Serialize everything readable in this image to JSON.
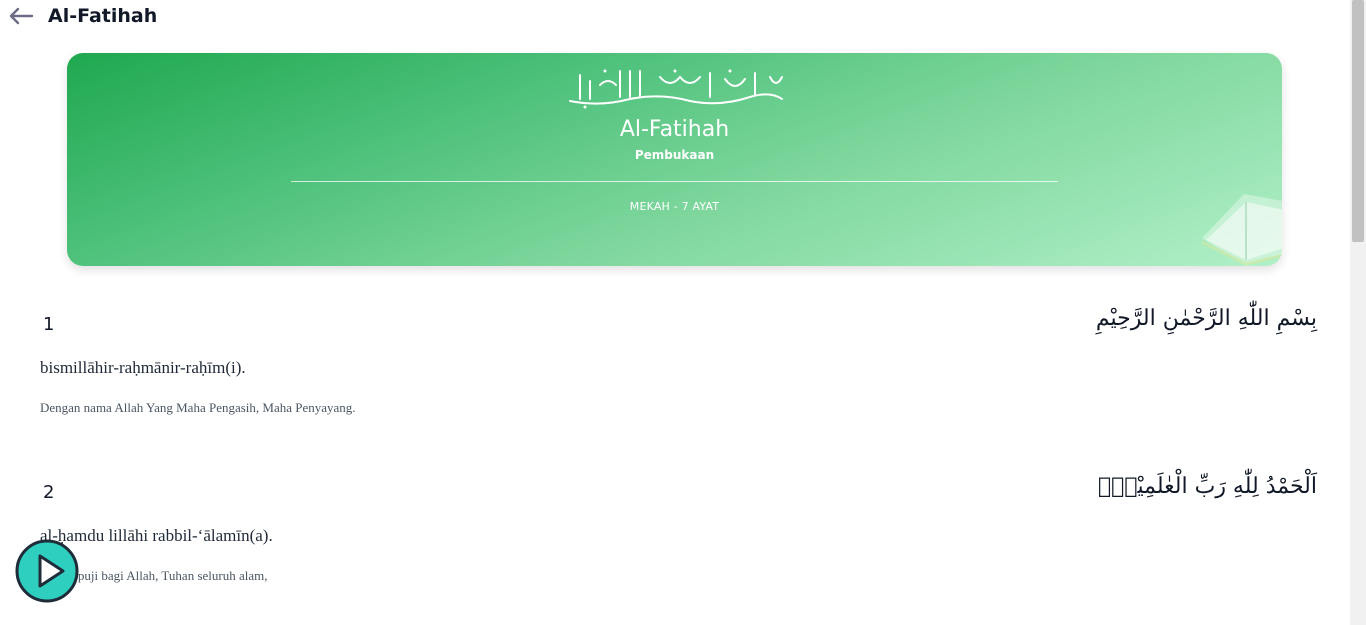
{
  "header": {
    "back_icon": "arrow-left-icon",
    "title": "Al-Fatihah"
  },
  "hero": {
    "basmala_art": "bismillah-calligraphy",
    "name": "Al-Fatihah",
    "meaning": "Pembukaan",
    "meta": "MEKAH - 7 AYAT",
    "decoration": "quran-book-icon"
  },
  "verses": [
    {
      "number": "1",
      "arabic": "بِسْمِ اللّٰهِ الرَّحْمٰنِ الرَّحِيْمِ",
      "latin": "bismillāhir-raḥmānir-raḥīm(i).",
      "translation": "Dengan nama Allah Yang Maha Pengasih, Maha Penyayang."
    },
    {
      "number": "2",
      "arabic": "اَلْحَمْدُ لِلّٰهِ رَبِّ الْعٰلَمِيْنَۙ",
      "latin": "al-ḥamdu lillāhi rabbil-‘ālamīn(a).",
      "translation": "Segala puji bagi Allah, Tuhan seluruh alam,"
    }
  ],
  "player": {
    "play_icon": "play-icon"
  },
  "colors": {
    "hero_start": "#1fa84f",
    "hero_end": "#b1f0c8",
    "play_button": "#2fcfbf"
  }
}
